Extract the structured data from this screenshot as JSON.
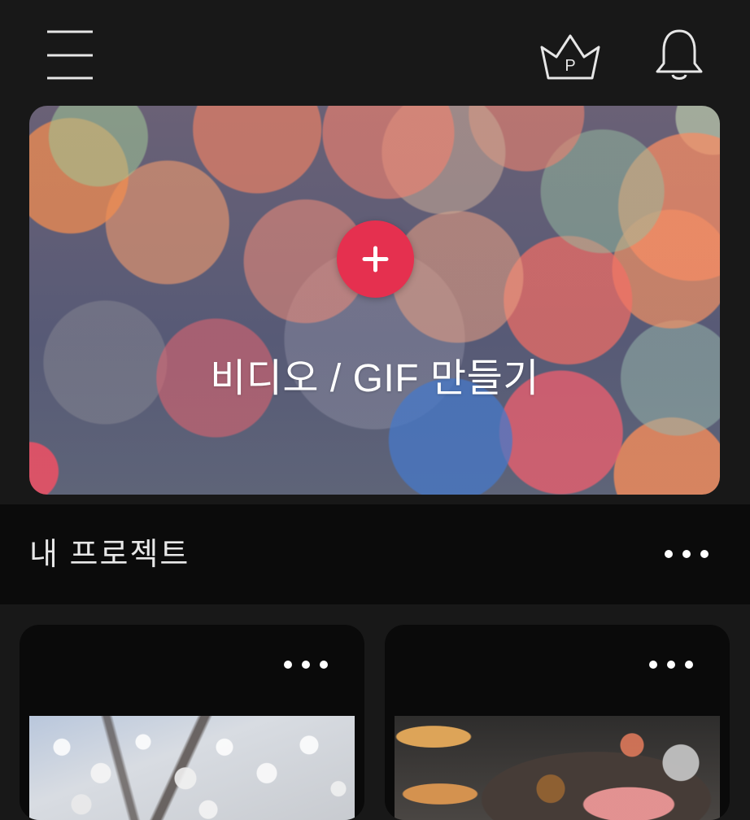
{
  "header": {
    "menu_icon": "hamburger-menu-icon",
    "premium_icon": "crown-icon",
    "premium_badge": "P",
    "notification_icon": "bell-icon"
  },
  "hero": {
    "label": "비디오 / GIF 만들기",
    "add_icon": "plus-icon",
    "accent_color": "#e5304f"
  },
  "projects": {
    "title": "내 프로젝트",
    "more_icon": "more-horizontal-icon",
    "cards": [
      {
        "more_icon": "more-horizontal-icon",
        "thumbnail": "cherry-blossom-photo"
      },
      {
        "more_icon": "more-horizontal-icon",
        "thumbnail": "korean-bbq-photo"
      }
    ]
  },
  "colors": {
    "background": "#181818",
    "section_background": "#0b0b0b",
    "card_background": "#0a0a0a",
    "accent": "#e5304f"
  }
}
